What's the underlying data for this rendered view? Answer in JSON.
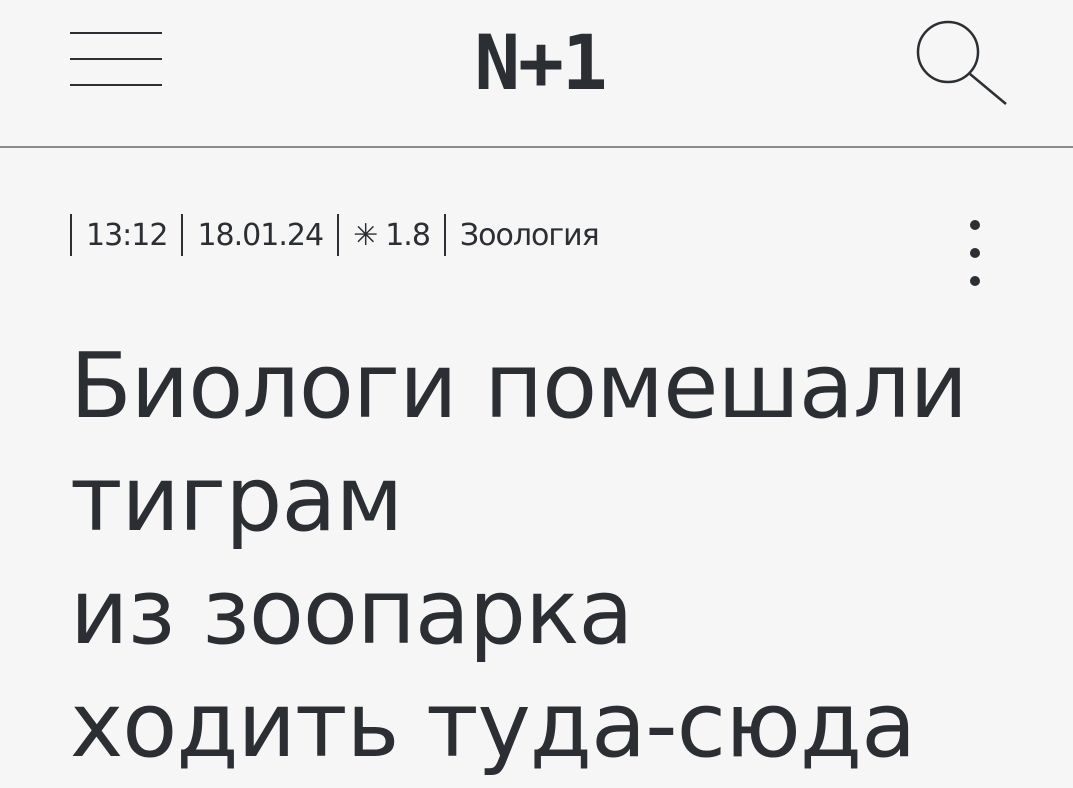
{
  "header": {
    "logo": "N+1",
    "menu_icon": "hamburger-menu-icon",
    "search_icon": "search-icon"
  },
  "meta": {
    "time": "13:12",
    "date": "18.01.24",
    "difficulty_icon": "asterisk-icon",
    "difficulty_symbol": "✳",
    "difficulty": "1.8",
    "category": "Зоология"
  },
  "more_icon": "vertical-dots-icon",
  "headline": {
    "lines": [
      "Биологи помешали",
      "тиграм",
      "из зоопарка",
      "ходить туда-сюда"
    ]
  },
  "colors": {
    "background": "#f6f6f6",
    "text": "#2b2f33",
    "divider": "#8c8c8c"
  }
}
